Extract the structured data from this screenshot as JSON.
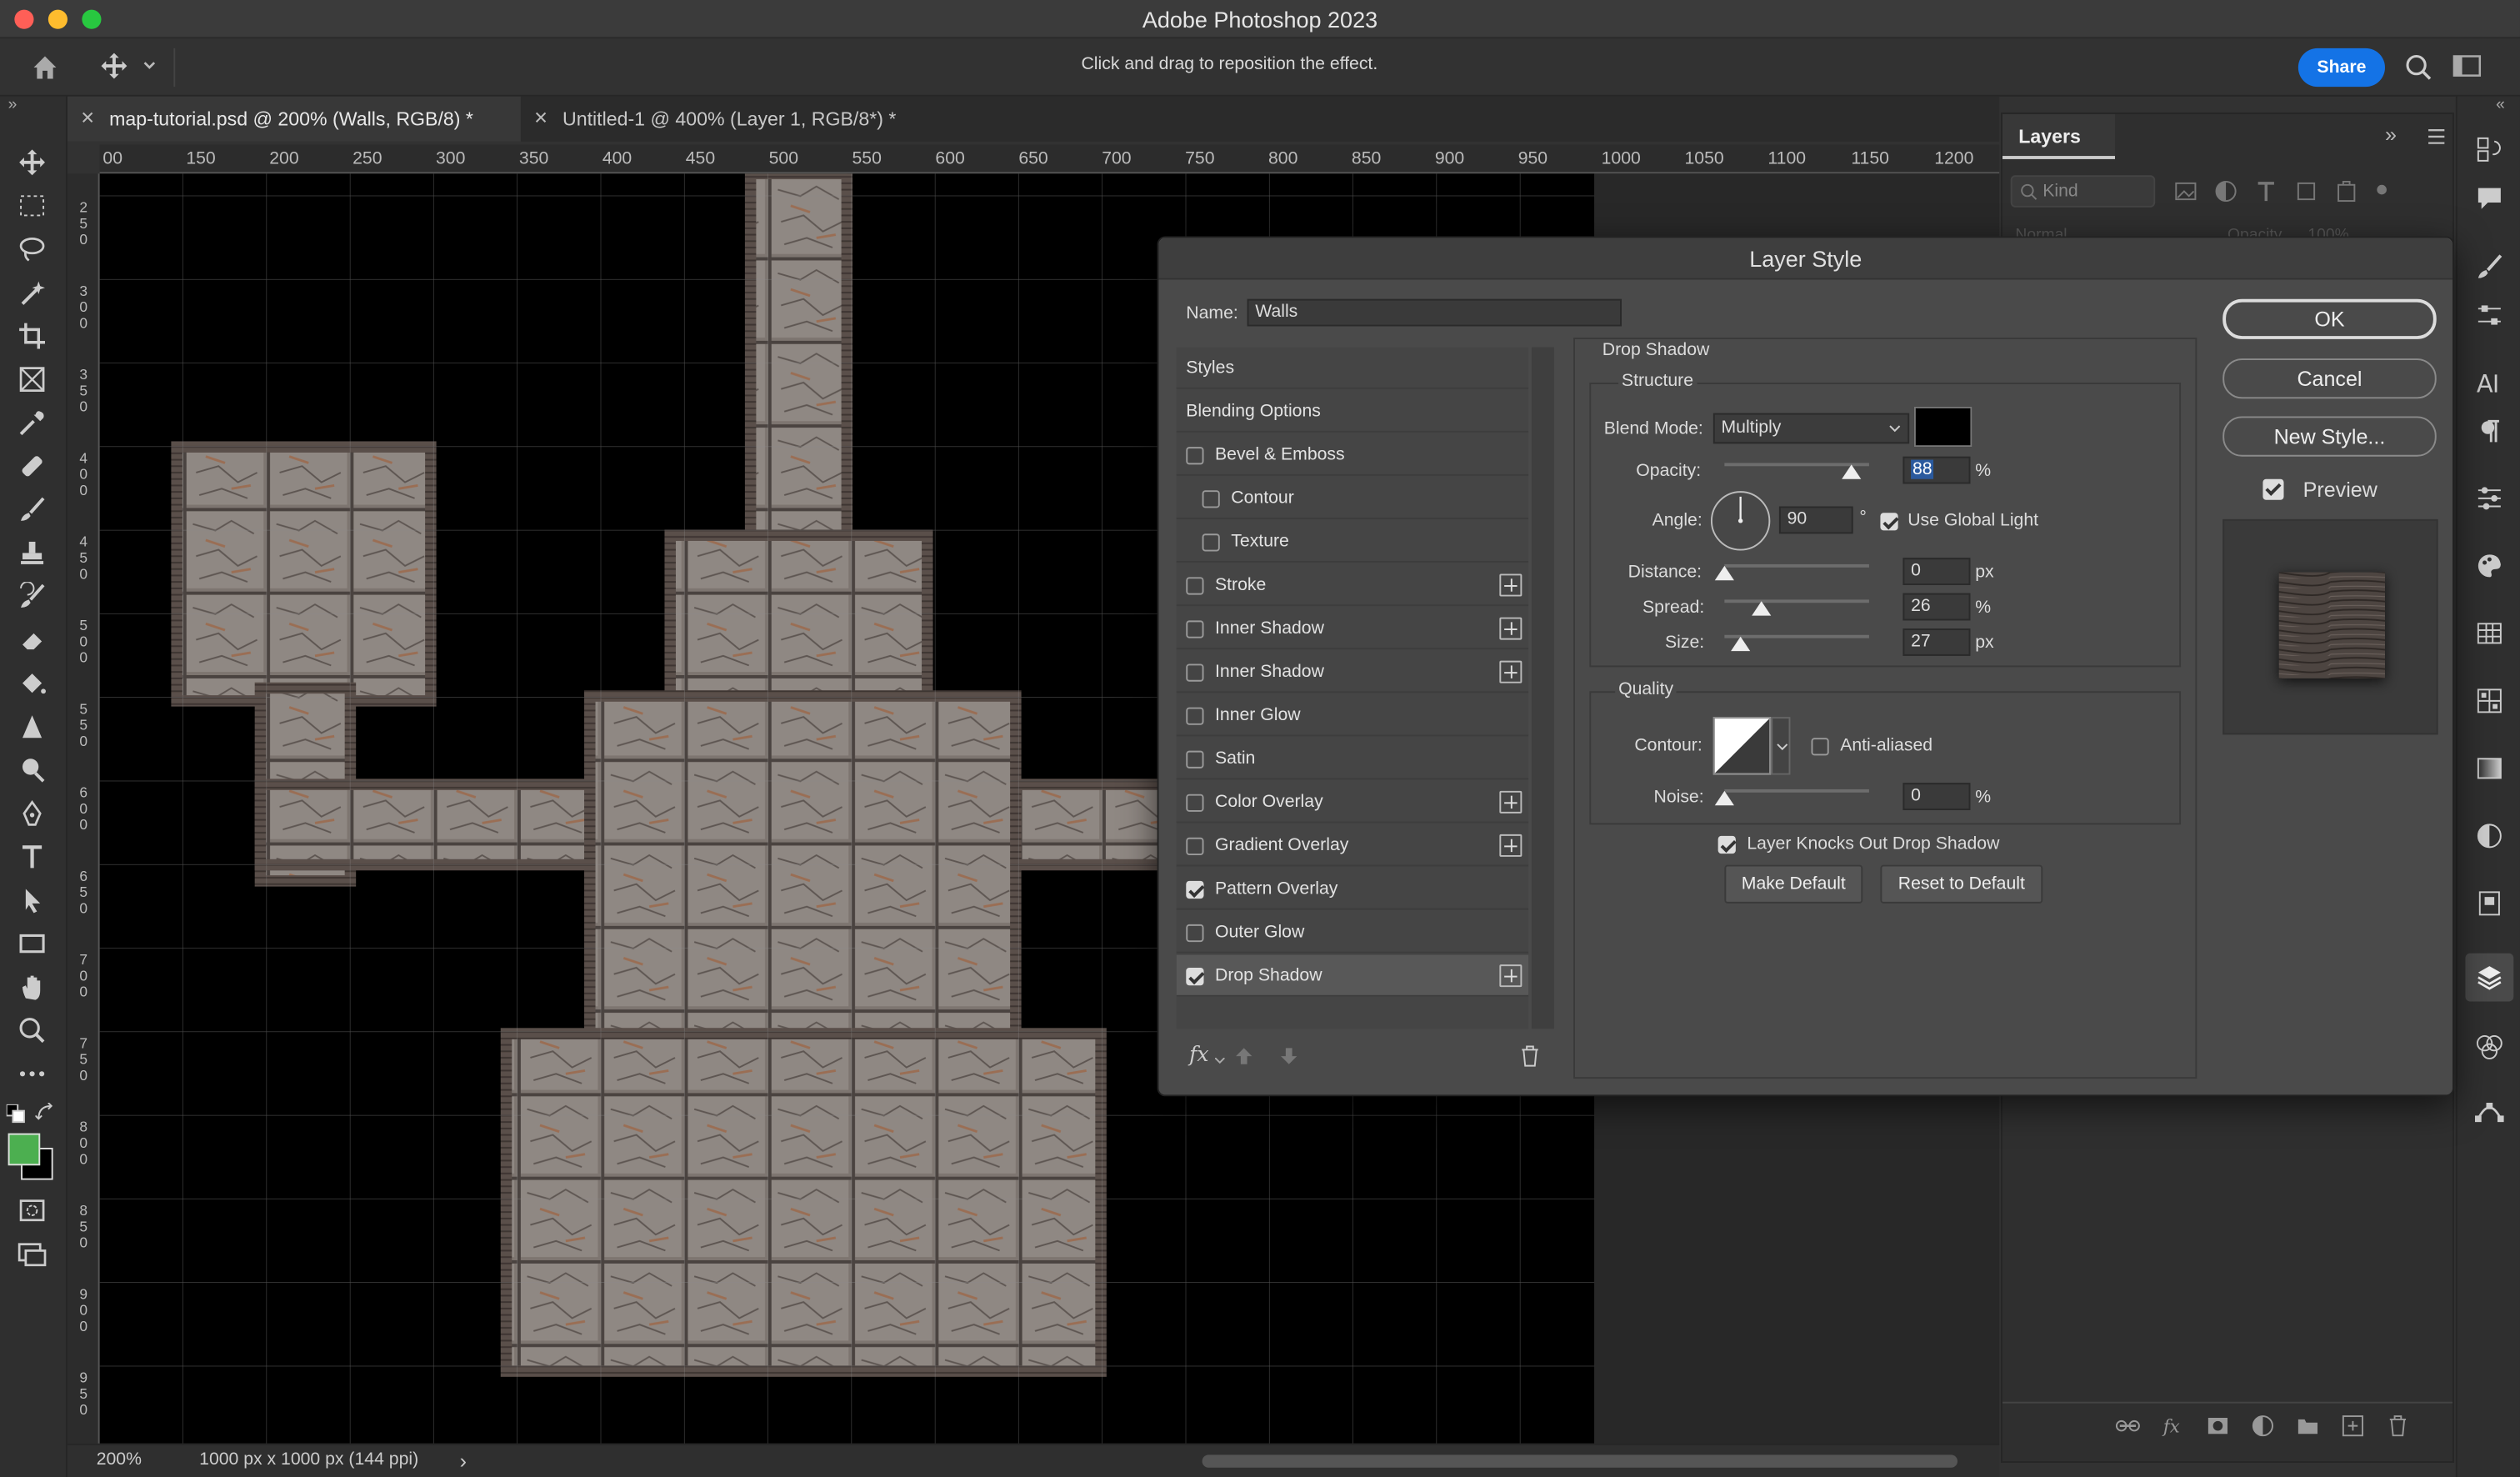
{
  "app": {
    "title": "Adobe Photoshop 2023"
  },
  "options_bar": {
    "hint": "Click and drag to reposition the effect.",
    "share_label": "Share"
  },
  "tabs": [
    {
      "label": "map-tutorial.psd @ 200% (Walls, RGB/8) *",
      "active": true
    },
    {
      "label": "Untitled-1 @ 400% (Layer 1, RGB/8*) *",
      "active": false
    }
  ],
  "ruler": {
    "top": [
      "00",
      "150",
      "200",
      "250",
      "300",
      "350",
      "400",
      "450",
      "500",
      "550",
      "600",
      "650",
      "700",
      "750",
      "800",
      "850",
      "900",
      "950",
      "1000",
      "1050",
      "1100",
      "1150",
      "1200"
    ],
    "left": [
      "250",
      "300",
      "350",
      "400",
      "450",
      "500",
      "550",
      "600",
      "650",
      "700",
      "750",
      "800",
      "850",
      "900",
      "950"
    ]
  },
  "status": {
    "zoom": "200%",
    "doc_info": "1000 px x 1000 px (144 ppi)",
    "arrow": "›"
  },
  "layers_panel": {
    "title": "Layers",
    "filter_placeholder": "Kind",
    "blend_mode": "Normal",
    "opacity_label": "Opacity",
    "opacity_value": "100%"
  },
  "dialog": {
    "title": "Layer Style",
    "name_label": "Name:",
    "name_value": "Walls",
    "styles": [
      {
        "label": "Styles",
        "checkbox": false,
        "checked": false,
        "plus": false,
        "indent": 0
      },
      {
        "label": "Blending Options",
        "checkbox": false,
        "checked": false,
        "plus": false,
        "indent": 0
      },
      {
        "label": "Bevel & Emboss",
        "checkbox": true,
        "checked": false,
        "plus": false,
        "indent": 1
      },
      {
        "label": "Contour",
        "checkbox": true,
        "checked": false,
        "plus": false,
        "indent": 2
      },
      {
        "label": "Texture",
        "checkbox": true,
        "checked": false,
        "plus": false,
        "indent": 2
      },
      {
        "label": "Stroke",
        "checkbox": true,
        "checked": false,
        "plus": true,
        "indent": 1
      },
      {
        "label": "Inner Shadow",
        "checkbox": true,
        "checked": false,
        "plus": true,
        "indent": 1
      },
      {
        "label": "Inner Shadow",
        "checkbox": true,
        "checked": false,
        "plus": true,
        "indent": 1
      },
      {
        "label": "Inner Glow",
        "checkbox": true,
        "checked": false,
        "plus": false,
        "indent": 1
      },
      {
        "label": "Satin",
        "checkbox": true,
        "checked": false,
        "plus": false,
        "indent": 1
      },
      {
        "label": "Color Overlay",
        "checkbox": true,
        "checked": false,
        "plus": true,
        "indent": 1
      },
      {
        "label": "Gradient Overlay",
        "checkbox": true,
        "checked": false,
        "plus": true,
        "indent": 1
      },
      {
        "label": "Pattern Overlay",
        "checkbox": true,
        "checked": true,
        "plus": false,
        "indent": 1
      },
      {
        "label": "Outer Glow",
        "checkbox": true,
        "checked": false,
        "plus": false,
        "indent": 1
      },
      {
        "label": "Drop Shadow",
        "checkbox": true,
        "checked": true,
        "plus": true,
        "indent": 1,
        "selected": true
      }
    ],
    "fx_label": "fx",
    "section_title": "Drop Shadow",
    "structure": {
      "title": "Structure",
      "blend_mode_label": "Blend Mode:",
      "blend_mode_value": "Multiply",
      "shadow_color": "#000000",
      "opacity_label": "Opacity:",
      "opacity_value": "88",
      "opacity_level": 0.88,
      "percent": "%",
      "angle_label": "Angle:",
      "angle_value": "90",
      "degree": "°",
      "use_global_light_label": "Use Global Light",
      "use_global_light": true,
      "distance_label": "Distance:",
      "distance_value": "0",
      "distance_level": 0,
      "spread_label": "Spread:",
      "spread_value": "26",
      "spread_level": 0.26,
      "size_label": "Size:",
      "size_value": "27",
      "size_level": 0.108,
      "px": "px"
    },
    "quality": {
      "title": "Quality",
      "contour_label": "Contour:",
      "anti_aliased_label": "Anti-aliased",
      "anti_aliased": false,
      "noise_label": "Noise:",
      "noise_value": "0",
      "noise_level": 0
    },
    "knocks_out_label": "Layer Knocks Out Drop Shadow",
    "knocks_out": true,
    "make_default_label": "Make Default",
    "reset_default_label": "Reset to Default",
    "ok_label": "OK",
    "cancel_label": "Cancel",
    "new_style_label": "New Style...",
    "preview_label": "Preview",
    "preview": true
  },
  "colors": {
    "accent": "#1473e6",
    "foreground_swatch": "#4caf50",
    "background_swatch": "#000000"
  }
}
